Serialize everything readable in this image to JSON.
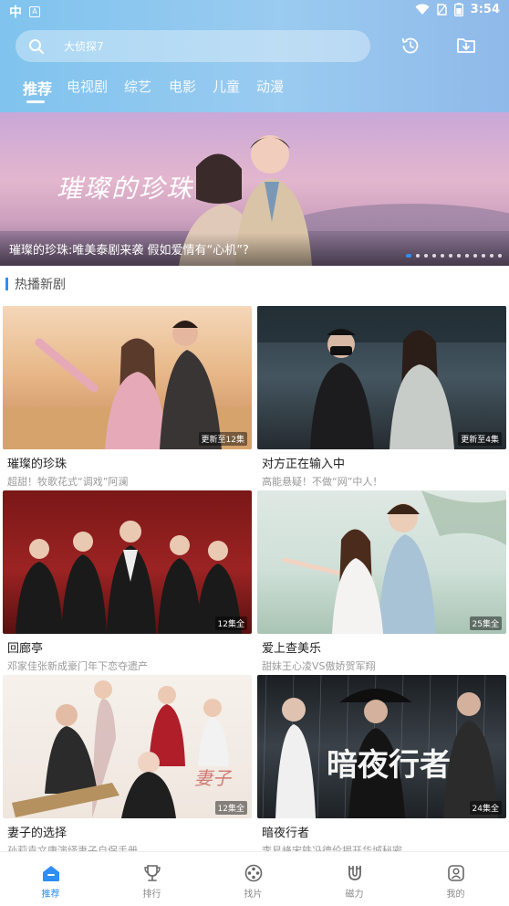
{
  "status_bar": {
    "time": "3:54",
    "left_glyph": "中",
    "left_box": "A"
  },
  "search": {
    "placeholder": "大侦探7"
  },
  "tabs": [
    {
      "label": "推荐",
      "active": true
    },
    {
      "label": "电视剧"
    },
    {
      "label": "综艺"
    },
    {
      "label": "电影"
    },
    {
      "label": "儿童"
    },
    {
      "label": "动漫"
    }
  ],
  "banner": {
    "script_text": "璀璨的珍珠",
    "caption": "璀璨的珍珠:唯美泰剧来袭 假如爱情有“心机”?",
    "dots_total": 12,
    "dots_active": 0
  },
  "section": {
    "title": "热播新剧"
  },
  "cards": [
    {
      "title": "璀璨的珍珠",
      "subtitle": "超甜！牧歌花式“调戏”阿澜",
      "badge": "更新至12集"
    },
    {
      "title": "对方正在输入中",
      "subtitle": "高能悬疑！不做“网”中人！",
      "badge": "更新至4集"
    },
    {
      "title": "回廊亭",
      "subtitle": "邓家佳张新成豪门年下恋夺遗产",
      "badge": "12集全"
    },
    {
      "title": "爱上查美乐",
      "subtitle": "甜妹王心凌VS傲娇贺军翔",
      "badge": "25集全"
    },
    {
      "title": "妻子的选择",
      "subtitle": "孙莉袁文康演绎妻子自保手册",
      "badge": "12集全"
    },
    {
      "title": "暗夜行者",
      "subtitle": "李易峰宋轶冯德伦揭开华城秘密",
      "badge": "24集全"
    }
  ],
  "bottom_nav": [
    {
      "label": "推荐",
      "icon": "home-icon",
      "active": true
    },
    {
      "label": "排行",
      "icon": "trophy-icon"
    },
    {
      "label": "找片",
      "icon": "film-reel-icon"
    },
    {
      "label": "磁力",
      "icon": "magnet-icon"
    },
    {
      "label": "我的",
      "icon": "profile-icon"
    }
  ],
  "colors": {
    "accent": "#2f8ef4",
    "header_gradient_start": "#7fc3ee",
    "header_gradient_end": "#8fb9e9"
  }
}
